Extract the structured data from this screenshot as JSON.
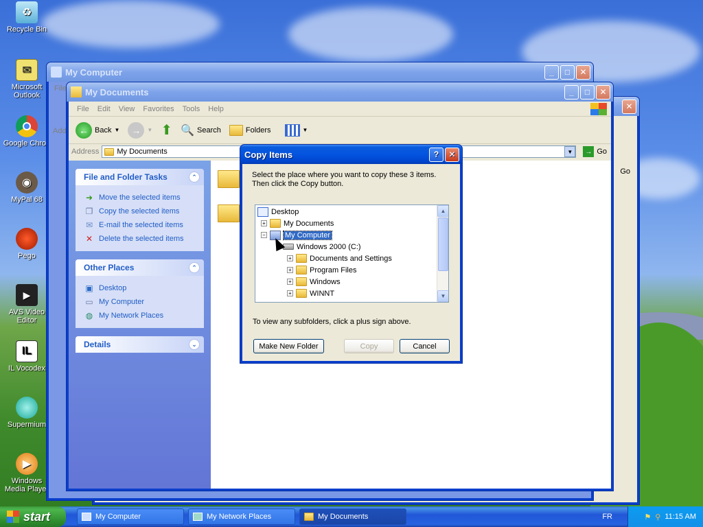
{
  "desktop": {
    "icons": [
      {
        "label": "Recycle Bin",
        "icon": "recycle-bin-icon"
      },
      {
        "label": "Microsoft Outlook",
        "icon": "outlook-icon"
      },
      {
        "label": "Google Chron",
        "icon": "chrome-icon"
      },
      {
        "label": "MyPal 68",
        "icon": "mypal-icon"
      },
      {
        "label": "Pego",
        "icon": "pego-icon"
      },
      {
        "label": "AVS Video Editor",
        "icon": "video-editor-icon"
      },
      {
        "label": "IL Vocodex",
        "icon": "vocodex-icon"
      },
      {
        "label": "Supermium",
        "icon": "supermium-icon"
      },
      {
        "label": "Windows Media Player",
        "icon": "media-player-icon"
      }
    ]
  },
  "windows": {
    "my_computer": {
      "title": "My Computer",
      "menu_file": "File",
      "address_short": "Add",
      "go": "Go"
    },
    "my_documents": {
      "title": "My Documents",
      "menu": [
        "File",
        "Edit",
        "View",
        "Favorites",
        "Tools",
        "Help"
      ],
      "toolbar": {
        "back": "Back",
        "search": "Search",
        "folders": "Folders"
      },
      "address_label": "Address",
      "address_value": "My Documents",
      "go": "Go",
      "file_tasks": {
        "title": "File and Folder Tasks",
        "items": [
          "Move the selected items",
          "Copy the selected items",
          "E-mail the selected items",
          "Delete the selected items"
        ]
      },
      "other_places": {
        "title": "Other Places",
        "items": [
          "Desktop",
          "My Computer",
          "My Network Places"
        ]
      },
      "details": {
        "title": "Details"
      }
    }
  },
  "dialog": {
    "title": "Copy Items",
    "instruction_line1": "Select the place where you want to copy these 3 items.",
    "instruction_line2": "Then click the Copy button.",
    "tree": {
      "desktop": "Desktop",
      "my_documents": "My Documents",
      "my_computer": "My Computer",
      "drive_c": "Windows 2000 (C:)",
      "documents_and_settings": "Documents and Settings",
      "program_files": "Program Files",
      "windows": "Windows",
      "winnt": "WINNT"
    },
    "hint": "To view any subfolders, click a plus sign above.",
    "buttons": {
      "make_new_folder": "Make New Folder",
      "copy": "Copy",
      "cancel": "Cancel"
    }
  },
  "taskbar": {
    "start": "start",
    "tasks": [
      "My Computer",
      "My Network Places",
      "My Documents"
    ],
    "language": "FR",
    "clock": "11:15 AM"
  }
}
